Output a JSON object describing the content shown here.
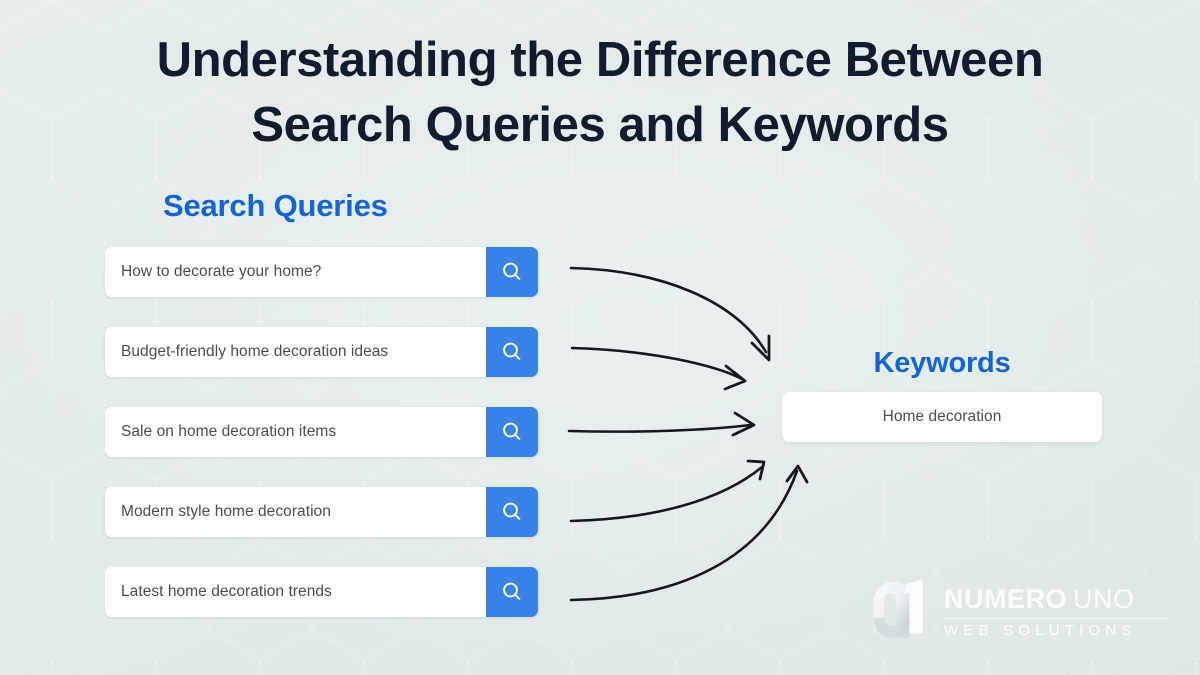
{
  "title": "Understanding the Difference Between\nSearch Queries and Keywords",
  "colors": {
    "background": "#e3eaea",
    "title_text": "#111d2e",
    "accent_blue": "#1564d4",
    "button_blue": "#3b82e8",
    "field_text": "#4c4c4c",
    "card_white": "#ffffff",
    "arrow": "#14181c"
  },
  "queries_section": {
    "heading": "Search Queries",
    "items": [
      {
        "text": "How to decorate your home?",
        "icon": "search-icon"
      },
      {
        "text": "Budget-friendly home decoration ideas",
        "icon": "search-icon"
      },
      {
        "text": "Sale on home decoration items",
        "icon": "search-icon"
      },
      {
        "text": "Modern style home decoration",
        "icon": "search-icon"
      },
      {
        "text": "Latest home decoration trends",
        "icon": "search-icon"
      }
    ]
  },
  "keywords_section": {
    "heading": "Keywords",
    "keyword": "Home decoration"
  },
  "arrows": {
    "count": 5,
    "description": "curved arrows from each search query to the keyword box"
  },
  "logo": {
    "mark": "numero-uno-n-mark",
    "name_bold": "NUMERO",
    "name_light": "UNO",
    "tagline": "WEB SOLUTIONS"
  }
}
